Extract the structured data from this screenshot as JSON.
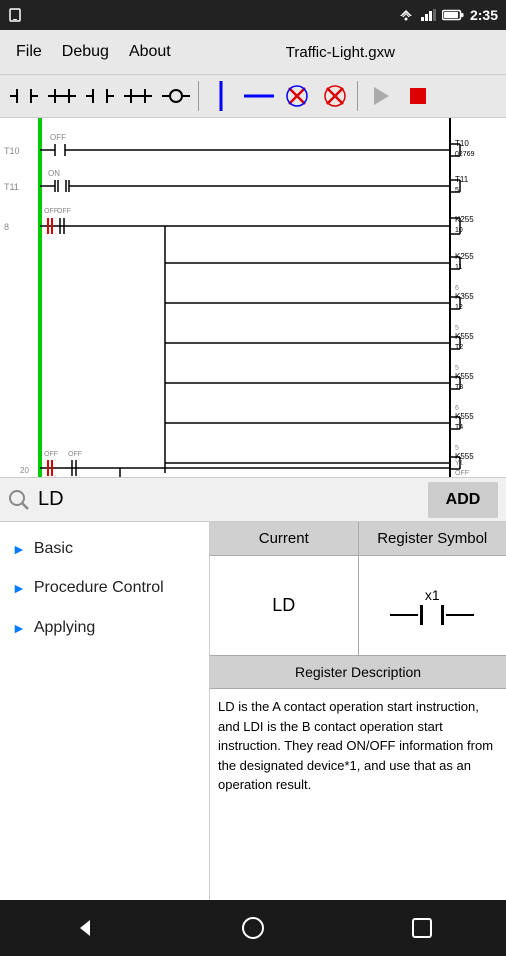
{
  "statusBar": {
    "time": "2:35",
    "icons": [
      "signal",
      "wifi",
      "battery"
    ]
  },
  "menuBar": {
    "items": [
      "File",
      "Debug",
      "About"
    ],
    "title": "Traffic-Light.gxw"
  },
  "toolbar": {
    "buttons": [
      {
        "id": "contact-no",
        "symbol": "┤├",
        "label": "NO Contact"
      },
      {
        "id": "contact-nc",
        "symbol": "┤┼├",
        "label": "NC Contact"
      },
      {
        "id": "contact-no2",
        "symbol": "┤├",
        "label": "NO Contact 2"
      },
      {
        "id": "contact-nc2",
        "symbol": "┤┼├",
        "label": "NC Contact 2"
      },
      {
        "id": "coil",
        "symbol": "( )",
        "label": "Coil"
      },
      {
        "id": "vertical",
        "symbol": "|",
        "label": "Vertical Line",
        "color": "#00f"
      },
      {
        "id": "horizontal",
        "symbol": "—",
        "label": "Horizontal Line",
        "color": "#00f"
      },
      {
        "id": "delete-v",
        "symbol": "✕",
        "label": "Delete Vertical",
        "color": "#d00"
      },
      {
        "id": "delete-h",
        "symbol": "✕",
        "label": "Delete Horizontal",
        "color": "#d00"
      },
      {
        "id": "play",
        "symbol": "▶",
        "label": "Run",
        "color": "#999"
      },
      {
        "id": "stop",
        "symbol": "■",
        "label": "Stop",
        "color": "#d00"
      }
    ]
  },
  "search": {
    "placeholder": "LD",
    "value": "LD",
    "addLabel": "ADD"
  },
  "sidebar": {
    "items": [
      {
        "id": "basic",
        "label": "Basic"
      },
      {
        "id": "procedure-control",
        "label": "Procedure Control"
      },
      {
        "id": "applying",
        "label": "Applying"
      }
    ]
  },
  "registerTable": {
    "headers": [
      "Current",
      "Register Symbol"
    ],
    "rows": [
      {
        "current": "LD",
        "symbolLabel": "x1",
        "symbolType": "NO-contact"
      }
    ]
  },
  "registerDescription": {
    "header": "Register Description",
    "text": "LD is the A contact operation start instruction, and LDI is the B contact operation start instruction. They read ON/OFF information from the designated device*1, and use that as an operation result."
  },
  "navBar": {
    "buttons": [
      "back",
      "home",
      "square"
    ]
  }
}
